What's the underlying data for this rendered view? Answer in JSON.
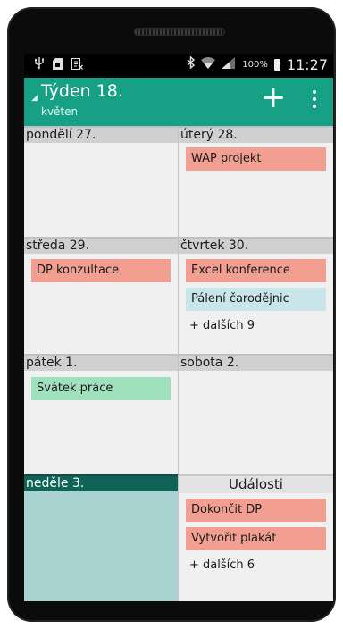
{
  "status_bar": {
    "icons_left": [
      "usb-icon",
      "sd-card-icon",
      "screenshot-icon"
    ],
    "icons_right": [
      "bluetooth-icon",
      "wifi-icon",
      "signal-icon",
      "battery-icon"
    ],
    "battery_percent": "100%",
    "time": "11:27"
  },
  "appbar": {
    "title": "Týden 18.",
    "subtitle": "květen",
    "add_label": "+",
    "color": "#16a085"
  },
  "days": [
    {
      "label": "pondělí 27.",
      "events": [],
      "more": ""
    },
    {
      "label": "úterý 28.",
      "events": [
        {
          "title": "WAP projekt",
          "color": "red"
        }
      ],
      "more": ""
    },
    {
      "label": "středa 29.",
      "events": [
        {
          "title": "DP konzultace",
          "color": "red"
        }
      ],
      "more": ""
    },
    {
      "label": "čtvrtek 30.",
      "events": [
        {
          "title": "Excel konference",
          "color": "red"
        },
        {
          "title": "Pálení čarodějnic",
          "color": "blue"
        }
      ],
      "more": "+ dalších 9"
    },
    {
      "label": "pátek 1.",
      "events": [
        {
          "title": "Svátek práce",
          "color": "green"
        }
      ],
      "more": ""
    },
    {
      "label": "sobota 2.",
      "events": [],
      "more": ""
    },
    {
      "label": "neděle 3.",
      "events": [],
      "more": "",
      "today": true
    }
  ],
  "events_panel": {
    "header": "Události",
    "items": [
      {
        "title": "Dokončit DP",
        "color": "red"
      },
      {
        "title": "Vytvořit plakát",
        "color": "red"
      }
    ],
    "more": "+ dalších 6"
  },
  "colors": {
    "event_red": "#f29f92",
    "event_blue": "#c8e6ea",
    "event_green": "#9fe0bd",
    "today_header": "#106357",
    "today_body": "#a9d3d1"
  }
}
